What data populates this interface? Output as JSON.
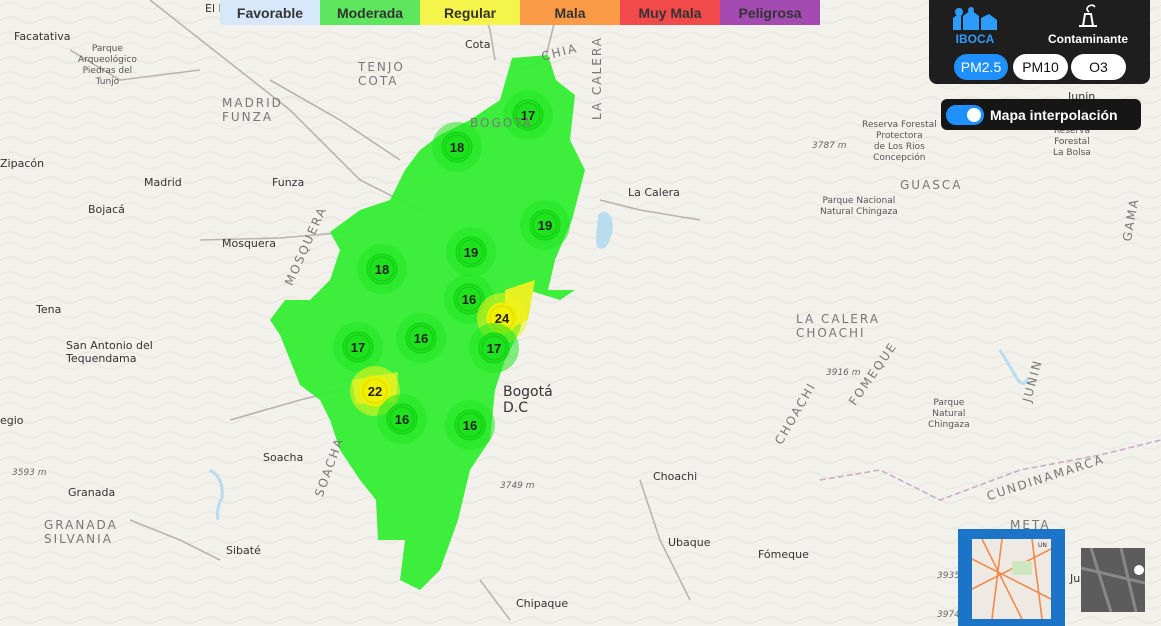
{
  "legend": [
    {
      "label": "Favorable",
      "color": "#d7e8fb"
    },
    {
      "label": "Moderada",
      "color": "#5ee65e"
    },
    {
      "label": "Regular",
      "color": "#f4f44a"
    },
    {
      "label": "Mala",
      "color": "#fb9a47"
    },
    {
      "label": "Muy Mala",
      "color": "#f24a4a"
    },
    {
      "label": "Peligrosa",
      "color": "#a34bb0"
    }
  ],
  "panel": {
    "iboca_label": "IBOCA",
    "contaminante_label": "Contaminante",
    "pollutants": [
      {
        "label": "PM2.5",
        "active": true
      },
      {
        "label": "PM10",
        "active": false
      },
      {
        "label": "O3",
        "active": false
      }
    ]
  },
  "interpolation": {
    "label": "Mapa interpolación",
    "enabled": true
  },
  "stations": [
    {
      "value": "17",
      "level": "moderada"
    },
    {
      "value": "18",
      "level": "moderada"
    },
    {
      "value": "19",
      "level": "moderada"
    },
    {
      "value": "18",
      "level": "moderada"
    },
    {
      "value": "19",
      "level": "moderada"
    },
    {
      "value": "16",
      "level": "moderada"
    },
    {
      "value": "24",
      "level": "regular"
    },
    {
      "value": "17",
      "level": "moderada"
    },
    {
      "value": "16",
      "level": "moderada"
    },
    {
      "value": "17",
      "level": "moderada"
    },
    {
      "value": "22",
      "level": "regular"
    },
    {
      "value": "16",
      "level": "moderada"
    },
    {
      "value": "16",
      "level": "moderada"
    }
  ],
  "map_labels": {
    "el_rosal": "El Rosal",
    "facatativa": "Facatativa",
    "parque_tunjo": "Parque\nArqueológico\nPiedras del\nTunjo",
    "cota": "Cota",
    "chia": "CHIA",
    "tenjo_cota": "TENJO\nCOTA",
    "madrid_funza": "MADRID\nFUNZA",
    "zipacon": "Zipacón",
    "madrid": "Madrid",
    "funza": "Funza",
    "bojaca": "Bojacá",
    "mosquera": "Mosquera",
    "mosquera_region": "MOSQUERA",
    "tena": "Tena",
    "san_antonio": "San Antonio del\nTequendama",
    "egio": "egio",
    "soacha": "Soacha",
    "soacha_region": "SOACHA",
    "granada": "Granada",
    "granada_silvania": "GRANADA\nSILVANIA",
    "sibate": "Sibaté",
    "la_calera": "La Calera",
    "la_calera_region": "LA CALERA",
    "la_calera_choachi": "LA CALERA\nCHOACHI",
    "bogota": "Bogotá\nD.C",
    "bogota_region": "BOGOTA",
    "choachi": "Choachi",
    "choachi_region": "CHOACHI",
    "fomeque_region": "FOMEQUE",
    "ubaque": "Ubaque",
    "fomeque": "Fómeque",
    "chipaque": "Chipaque",
    "guasca": "GUASCA",
    "junin": "Junin",
    "junin_region": "JUNIN",
    "gama": "GAMA",
    "cundinamarca": "CUNDINAMARCA",
    "meta": "META",
    "reserva_rios": "Reserva Forestal\nProtectora\nde Los Rios\nConcepción",
    "reserva_bolsa": "Reserva\nForestal\nLa Bolsa",
    "chingaza_nat": "Parque Nacional\nNatural Chingaza",
    "chingaza_nat2": "Parque\nNatural\nChingaza",
    "e3787": "3787 m",
    "e3916": "3916 m",
    "e3749": "3749 m",
    "e3593": "3593 m",
    "e3935": "3935",
    "e3974": "3974",
    "ju": "Ju",
    "minimap_label": "UN"
  }
}
